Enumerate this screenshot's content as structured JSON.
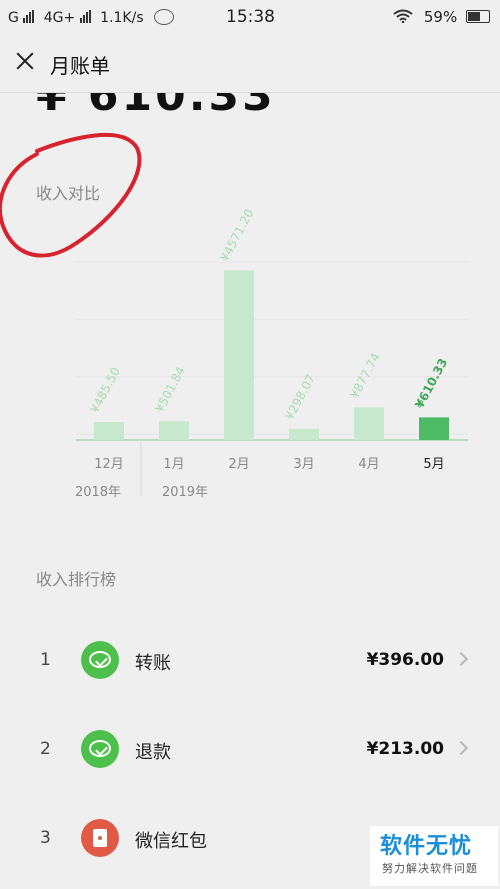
{
  "status_bar": {
    "carrier_left": "G",
    "network": "4G+",
    "speed": "1.1K/s",
    "time": "15:38",
    "battery": "59%",
    "icons": [
      "signal-icon",
      "wechat-notification-icon",
      "wifi-icon",
      "battery-icon"
    ]
  },
  "nav": {
    "title": "月账单",
    "close_icon": "close-icon"
  },
  "summary": {
    "amount_partial": "¥ 610.33"
  },
  "comparison": {
    "title": "收入对比"
  },
  "chart_data": {
    "type": "bar",
    "categories": [
      "12月",
      "1月",
      "2月",
      "3月",
      "4月",
      "5月"
    ],
    "year_labels": [
      {
        "label": "2018年",
        "under": "12月"
      },
      {
        "label": "2019年",
        "under": "1月"
      }
    ],
    "values": [
      485.5,
      501.84,
      4571.2,
      298.07,
      877.74,
      610.33
    ],
    "value_labels": [
      "¥485.50",
      "¥501.84",
      "¥4571.20",
      "¥298.07",
      "¥877.74",
      "¥610.33"
    ],
    "highlight_index": 5,
    "ylim": [
      0,
      4800
    ],
    "colors": {
      "bar": "#c6e8cc",
      "bar_highlight": "#4dbb66",
      "label": "#a8dcb2",
      "label_highlight": "#3ea857",
      "axis": "#a8dcb2",
      "grid": "#e4e4e4"
    }
  },
  "ranking": {
    "title": "收入排行榜",
    "items": [
      {
        "rank": "1",
        "name": "转账",
        "amount": "¥396.00",
        "icon": "wechat-transfer-icon",
        "color": "#4cc04a"
      },
      {
        "rank": "2",
        "name": "退款",
        "amount": "¥213.00",
        "icon": "wechat-refund-icon",
        "color": "#4cc04a"
      },
      {
        "rank": "3",
        "name": "微信红包",
        "amount": "",
        "icon": "red-packet-icon",
        "color": "#e05a45"
      }
    ]
  },
  "watermark": {
    "title": "软件无忧",
    "subtitle": "努力解决软件问题"
  },
  "annotation_color": "#d8222e"
}
